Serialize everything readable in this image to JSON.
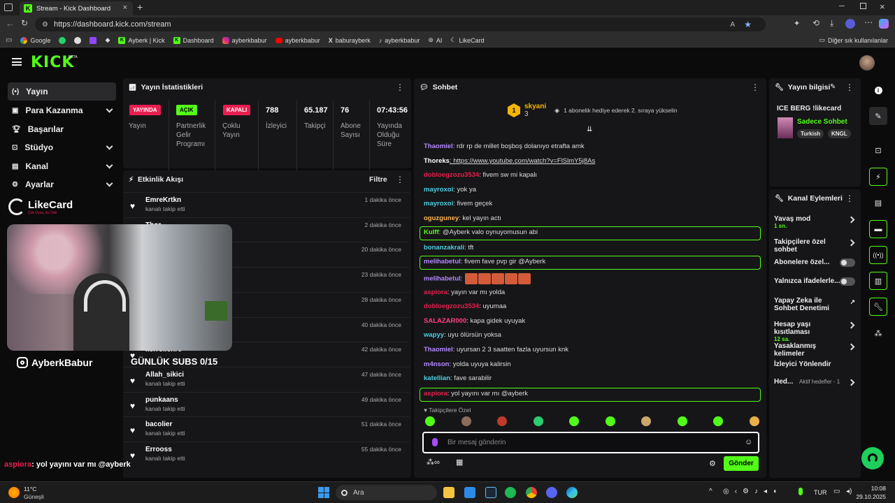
{
  "browser": {
    "tab_title": "Stream - Kick Dashboard",
    "url": "https://dashboard.kick.com/stream",
    "bookmarks": [
      "Google",
      "Ayberk | Kick",
      "Dashboard",
      "ayberkbabur",
      "ayberkbabur",
      "baburayberk",
      "ayberkbabur",
      "AI",
      "LikeCard"
    ],
    "other_bookmarks": "Diğer sık kullanılanlar"
  },
  "app": {
    "logo": "KICK",
    "logo_sup": "BETA"
  },
  "sidebar": {
    "items": [
      {
        "label": "Yayın",
        "active": true
      },
      {
        "label": "Para Kazanma"
      },
      {
        "label": "Başarılar"
      },
      {
        "label": "Stüdyo"
      },
      {
        "label": "Kanal"
      },
      {
        "label": "Ayarlar"
      }
    ]
  },
  "stats": {
    "title": "Yayın İstatistikleri",
    "cols": [
      {
        "badge": "YAYINDA",
        "label": "Yayın"
      },
      {
        "badge": "AÇIK",
        "label": "Partnerlik Gelir Programı"
      },
      {
        "badge": "KAPALI",
        "label": "Çoklu Yayın"
      },
      {
        "value": "788",
        "label": "İzleyici"
      },
      {
        "value": "65.187",
        "label": "Takipçi"
      },
      {
        "value": "76",
        "label": "Abone Sayısı"
      },
      {
        "value": "07:43:56",
        "label": "Yayında Olduğu Süre"
      }
    ],
    "colors": {
      "live": "#e91e50",
      "on": "#53fc18",
      "off": "#e91e50"
    }
  },
  "activity": {
    "title": "Etkinlik Akışı",
    "filter": "Filtre",
    "rows": [
      {
        "name": "EmreKrtkn",
        "sub": "kanalı takip etti",
        "time": "1 dakika önce"
      },
      {
        "name": "Thor...",
        "sub": "",
        "time": "2 dakika önce"
      },
      {
        "name": "",
        "sub": "",
        "time": "20 dakika önce"
      },
      {
        "name": "",
        "sub": "",
        "time": "23 dakika önce"
      },
      {
        "name": "",
        "sub": "",
        "time": "28 dakika önce"
      },
      {
        "name": "",
        "sub": "",
        "time": "40 dakika önce"
      },
      {
        "name": "kerroilenro",
        "sub": "",
        "time": "42 dakika önce"
      },
      {
        "name": "Allah_sikici",
        "sub": "kanalı takip etti",
        "time": "47 dakika önce"
      },
      {
        "name": "punkaans",
        "sub": "kanalı takip etti",
        "time": "49 dakika önce"
      },
      {
        "name": "bacolier",
        "sub": "kanalı takip etti",
        "time": "51 dakika önce"
      },
      {
        "name": "Errooss",
        "sub": "kanalı takip etti",
        "time": "55 dakika önce"
      }
    ]
  },
  "overlay": {
    "brand": "LikeCard",
    "brand_sub": "Çok Oyna, Az Öde",
    "instagram": "AyberkBabur",
    "subs_goal": "GÜNLÜK SUBS 0/15",
    "last_chat_user": "aspiora",
    "last_chat_msg": ": yol yayını var mı @ayberk"
  },
  "chat": {
    "title": "Sohbet",
    "pinned_user": "skyani",
    "pinned_count": "3",
    "pinned_text": "1 abonelik hediye ederek 2. sıraya yükselin",
    "messages": [
      {
        "user": "Thaomiel",
        "color": "#b388ff",
        "text": ": rdr rp de millet boşboş dolanıyo etrafta amk"
      },
      {
        "user": "Thoreks",
        "color": "#ffffff",
        "text": ": https://www.youtube.com/watch?v=FlSlmY5j8As"
      },
      {
        "user": "dobloegzozu3534",
        "color": "#e91e50",
        "text": ": fivem sw mi kapalı"
      },
      {
        "user": "mayroxoi",
        "color": "#4dd0e1",
        "text": ": yok ya"
      },
      {
        "user": "mayroxoi",
        "color": "#4dd0e1",
        "text": ": fivem geçek"
      },
      {
        "user": "oguzguney",
        "color": "#ffb74d",
        "text": ": kel yayın actı"
      },
      {
        "user": "Kulff",
        "color": "#53fc18",
        "text": ": @Ayberk valo oynuyomusun abi",
        "highlight": true
      },
      {
        "user": "bonanzakrali",
        "color": "#4dd0e1",
        "text": ": tft"
      },
      {
        "user": "melihabetul",
        "color": "#b388ff",
        "text": ": fivem fave pvp gir @Ayberk",
        "highlight": true
      },
      {
        "user": "melihabetul",
        "color": "#b388ff",
        "text": ":"
      },
      {
        "user": "aspiora",
        "color": "#e91e50",
        "text": ": yayın var mı yolda"
      },
      {
        "user": "dobloegzozu3534",
        "color": "#e91e50",
        "text": ": uyumaa"
      },
      {
        "user": "SALAZAR000",
        "color": "#ff4081",
        "text": ": kapa gidek uyuyak"
      },
      {
        "user": "wapyy",
        "color": "#4dd0e1",
        "text": ": uyu ölürsün yoksa"
      },
      {
        "user": "Thaomiel",
        "color": "#b388ff",
        "text": ": uyursan 2 3 saatten fazla uyursun knk"
      },
      {
        "user": "m4nson",
        "color": "#b388ff",
        "text": ": yolda uyuya kalirsin"
      },
      {
        "user": "katellian",
        "color": "#4dd0e1",
        "text": ": fave sarabilir"
      },
      {
        "user": "aspiora",
        "color": "#e91e50",
        "text": ": yol yayını var mı @ayberk",
        "highlight": true
      }
    ],
    "followers_only": "Takipçilere Özel",
    "input_placeholder": "Bir mesaj gönderin",
    "send": "Gönder"
  },
  "stream_info": {
    "title": "Yayın bilgisi",
    "stream_title": "ICE BERG !likecard",
    "category": "Sadece Sohbet",
    "tags": [
      "Turkish",
      "KNGL"
    ]
  },
  "channel_actions": {
    "title": "Kanal Eylemleri",
    "items": [
      {
        "label": "Yavaş mod",
        "sub": "1 sn.",
        "type": "chev"
      },
      {
        "label": "Takipçilere özel sohbet",
        "type": "chev"
      },
      {
        "label": "Abonelere özel...",
        "type": "toggle"
      },
      {
        "label": "Yalnızca ifadelerle...",
        "type": "toggle"
      },
      {
        "label": "Yapay Zeka ile Sohbet Denetimi",
        "type": "ext"
      },
      {
        "label": "Hesap yaşı kısıtlaması",
        "sub": "12 sa.",
        "type": "chev"
      },
      {
        "label": "Yasaklanmış kelimeler",
        "type": "chev"
      },
      {
        "label": "İzleyici Yönlendir",
        "type": "none"
      },
      {
        "label": "Hed...",
        "sub": "Aktif hedefler - 1",
        "type": "chev"
      }
    ]
  },
  "taskbar": {
    "weather_temp": "11°C",
    "weather_desc": "Güneşli",
    "search": "Ara",
    "lang": "TUR",
    "time": "10:08",
    "date": "29.10.2025"
  }
}
